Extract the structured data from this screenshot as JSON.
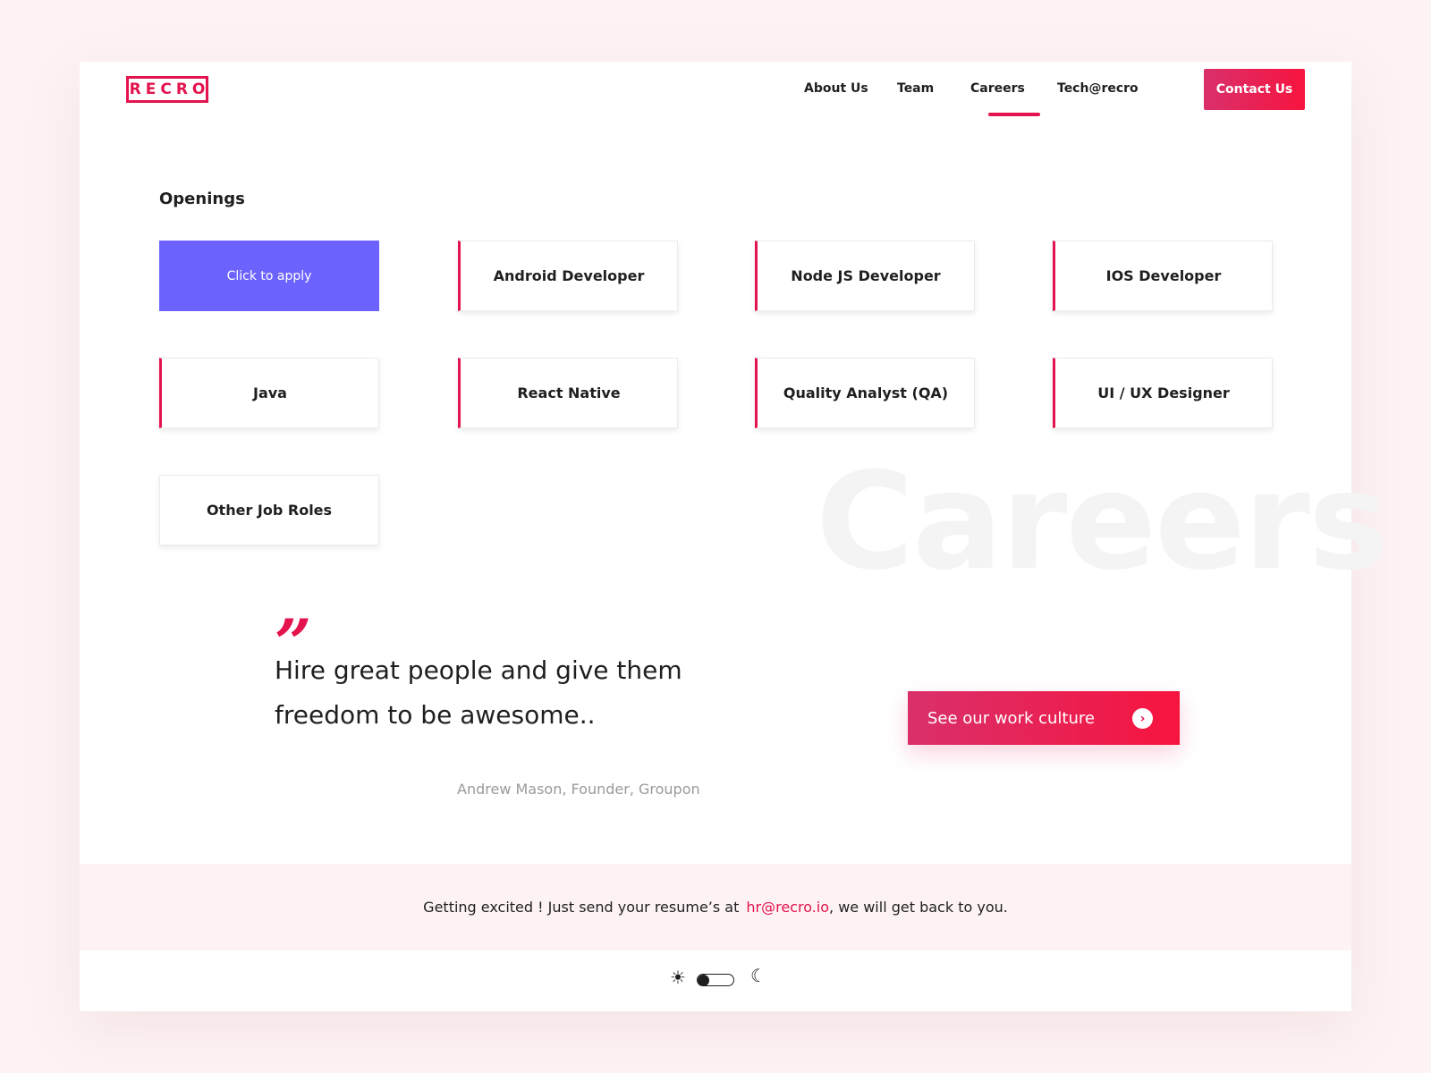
{
  "header": {
    "logo_text": "RECRO",
    "nav": [
      {
        "label": "About Us"
      },
      {
        "label": "Team"
      },
      {
        "label": "Careers",
        "active": true
      },
      {
        "label": "Tech@recro"
      }
    ],
    "contact_label": "Contact Us"
  },
  "openings": {
    "title": "Openings",
    "apply_label": "Click to apply",
    "jobs": [
      "Android Developer",
      "Node JS Developer",
      "IOS Developer",
      "Java",
      "React Native",
      "Quality Analyst (QA)",
      "UI / UX Designer",
      "Other Job Roles"
    ]
  },
  "watermark": "Careers",
  "quote": {
    "mark": "”",
    "text": "Hire great people and give them freedom to be awesome..",
    "author": "Andrew Mason, Founder, Groupon"
  },
  "culture_button": {
    "label": "See our work culture",
    "icon": "chevron-right-icon"
  },
  "resume": {
    "text_before": "Getting excited ! Just send your resume’s at",
    "email": "hr@recro.io",
    "text_after": ", we will get back to you."
  },
  "theme_toggle": {
    "sun_icon": "☀",
    "moon_icon": "☾",
    "mode": "light"
  },
  "colors": {
    "accent": "#e3134d",
    "apply_bg": "#6c63ff",
    "page_bg": "#fdf3f4"
  }
}
